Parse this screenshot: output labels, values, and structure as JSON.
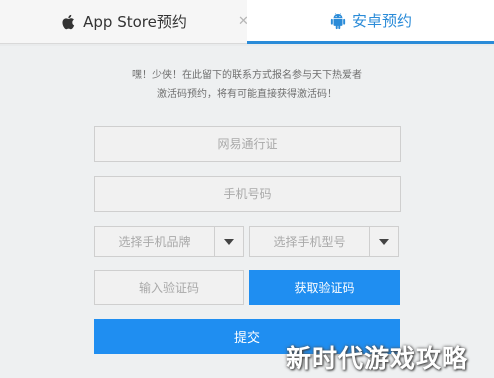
{
  "tabs": {
    "ios_label": "App Store预约",
    "android_label": "安卓预约",
    "close_glyph": "✕"
  },
  "description": {
    "line1": "嘿！少侠！在此留下的联系方式报名参与天下热爱者",
    "line2": "激活码预约，将有可能直接获得激活码！"
  },
  "form": {
    "account_placeholder": "网易通行证",
    "phone_placeholder": "手机号码",
    "brand_select": "选择手机品牌",
    "model_select": "选择手机型号",
    "code_placeholder": "输入验证码",
    "get_code_label": "获取验证码",
    "submit_label": "提交"
  },
  "watermark": "新时代游戏攻略",
  "icons": {
    "ios": "apple-icon",
    "android": "android-icon",
    "dropdown": "triangle-down-icon"
  },
  "colors": {
    "accent": "#1f8ef1",
    "tab_active": "#2a8bd8"
  }
}
